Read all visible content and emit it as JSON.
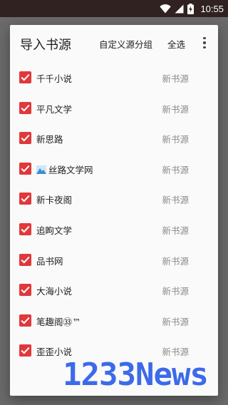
{
  "status_bar": {
    "time": "10:55",
    "icons": [
      "wifi-icon",
      "signal-icon",
      "battery-charging-icon"
    ]
  },
  "dialog": {
    "title": "导入书源",
    "custom_group_label": "自定义源分组",
    "select_all_label": "全选",
    "more_icon": "more-vert-icon"
  },
  "items": [
    {
      "name": "千千小说",
      "group": "新书源",
      "checked": true
    },
    {
      "name": "平凡文学",
      "group": "新书源",
      "checked": true
    },
    {
      "name": "新思路",
      "group": "新书源",
      "checked": true
    },
    {
      "name": "丝路文学网",
      "group": "新书源",
      "checked": true,
      "icon": "site-logo-icon"
    },
    {
      "name": "新卡夜阁",
      "group": "新书源",
      "checked": true
    },
    {
      "name": "追眗文学",
      "group": "新书源",
      "checked": true
    },
    {
      "name": "品书网",
      "group": "新书源",
      "checked": true
    },
    {
      "name": "大海小说",
      "group": "新书源",
      "checked": true
    },
    {
      "name": "笔趣阁㉝™",
      "group": "新书源",
      "checked": true
    },
    {
      "name": "歪歪小说",
      "group": "新书源",
      "checked": true
    }
  ],
  "watermark": {
    "text": "1233News"
  },
  "colors": {
    "accent_checkbox": "#e0383b",
    "status_bar": "#2f2220",
    "scrim": "#6a6a6a",
    "dialog_bg": "#fafafa",
    "watermark": "#2d5ee8"
  }
}
